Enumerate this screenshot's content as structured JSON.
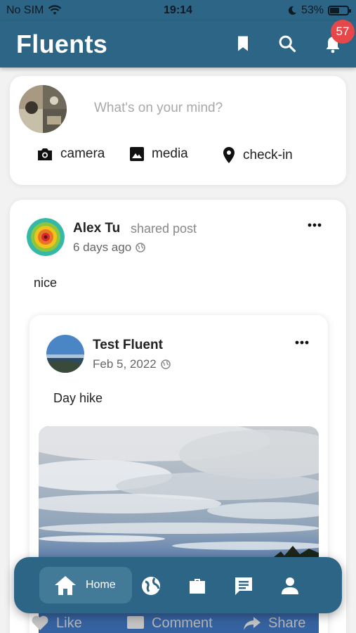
{
  "status_bar": {
    "carrier": "No SIM",
    "time": "19:14",
    "battery": "53%"
  },
  "app": {
    "title": "Fluents",
    "notification_count": "57"
  },
  "composer": {
    "placeholder": "What's on your mind?",
    "actions": [
      {
        "label": "camera",
        "icon": "camera-icon"
      },
      {
        "label": "media",
        "icon": "image-icon"
      },
      {
        "label": "check-in",
        "icon": "location-pin-icon"
      }
    ]
  },
  "post": {
    "author": "Alex Tu",
    "action": "shared post",
    "time": "6 days ago",
    "text": "nice",
    "shared": {
      "author": "Test Fluent",
      "date": "Feb 5, 2022",
      "text": "Day hike"
    }
  },
  "post_actions": {
    "like": "Like",
    "comment": "Comment",
    "share": "Share"
  },
  "bottom_nav": {
    "active": "Home",
    "items": [
      "home-icon",
      "globe-icon",
      "briefcase-icon",
      "chat-icon",
      "profile-icon"
    ]
  },
  "colors": {
    "primary": "#2c6586",
    "badge": "#e8474a",
    "nav_active": "#427a97"
  }
}
